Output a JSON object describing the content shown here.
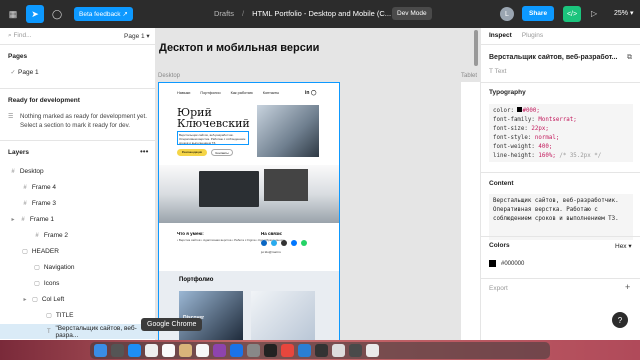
{
  "topbar": {
    "beta_label": "Beta feedback",
    "crumb_1": "Drafts",
    "crumb_sep": "/",
    "file_name": "HTML Portfolio - Desktop and Mobile (C...",
    "dev_mode": "Dev Mode",
    "avatar_letter": "L",
    "share_label": "Share",
    "zoom": "25%"
  },
  "left": {
    "search_placeholder": "Find...",
    "page_selector": "Page 1",
    "pages_title": "Pages",
    "page_item": "Page 1",
    "ready_title": "Ready for development",
    "ready_text": "Nothing marked as ready for development yet. Select a section to mark it ready for dev.",
    "layers_title": "Layers",
    "layers": [
      {
        "label": "Desktop"
      },
      {
        "label": "Frame 4"
      },
      {
        "label": "Frame 3"
      },
      {
        "label": "Frame 1"
      },
      {
        "label": "Frame 2"
      },
      {
        "label": "HEADER"
      },
      {
        "label": "Navigation"
      },
      {
        "label": "Icons"
      },
      {
        "label": "Col Left"
      },
      {
        "label": "TITLE"
      },
      {
        "label": "\"Верстальщик сайтов, веб-разра..."
      }
    ]
  },
  "tooltip": "Google Chrome",
  "canvas": {
    "title": "Десктоп и мобильная версии",
    "frame_label": "Desktop",
    "tablet_label": "Tablet",
    "design": {
      "nav": [
        "Навыки",
        "Портфолио",
        "Как работаю",
        "Контакты"
      ],
      "social": "in ◯",
      "name_line1": "Юрий",
      "name_line2": "Ключевский",
      "subline": "Верстальщик сайтов, веб-разработчик. Оперативная верстка. Работаю с соблюдением сроков и выполнением ТЗ.",
      "btn1": "Рекомендации",
      "btn2": "Контакты",
      "skills_title": "Что я умею:",
      "skills_text": "• Верстка сайтов • Адаптивная верстка • Работа с Figma • Кроссбраузерность",
      "contact_title": "На связи:",
      "email": "jur.klu@mail.ru",
      "portfolio_title": "Портфолио",
      "card_text": "Discover"
    }
  },
  "right": {
    "tab_inspect": "Inspect",
    "tab_plugins": "Plugins",
    "layer_name": "Верстальщик сайтов, веб-разработ...",
    "layer_type": "Text",
    "typography_title": "Typography",
    "css": [
      {
        "k": "color:",
        "v": "#000;"
      },
      {
        "k": "font-family:",
        "v": "Montserrat;"
      },
      {
        "k": "font-size:",
        "v": "22px;"
      },
      {
        "k": "font-style:",
        "v": "normal;"
      },
      {
        "k": "font-weight:",
        "v": "400;"
      },
      {
        "k": "line-height:",
        "v": "160%;",
        "c": "/* 35.2px */"
      }
    ],
    "content_title": "Content",
    "content_text": "Верстальщик сайтов, веб-разработчик. Оперативная верстка. Работаю с соблюдением сроков и выполнением ТЗ.",
    "colors_title": "Colors",
    "color_format": "Hex",
    "color_value": "#000000",
    "export_title": "Export",
    "add": "+"
  },
  "help": "?",
  "colors": {
    "accent": "#0d99ff",
    "dev_green": "#1bc47d",
    "canvas_bg": "#e5e5e5"
  }
}
